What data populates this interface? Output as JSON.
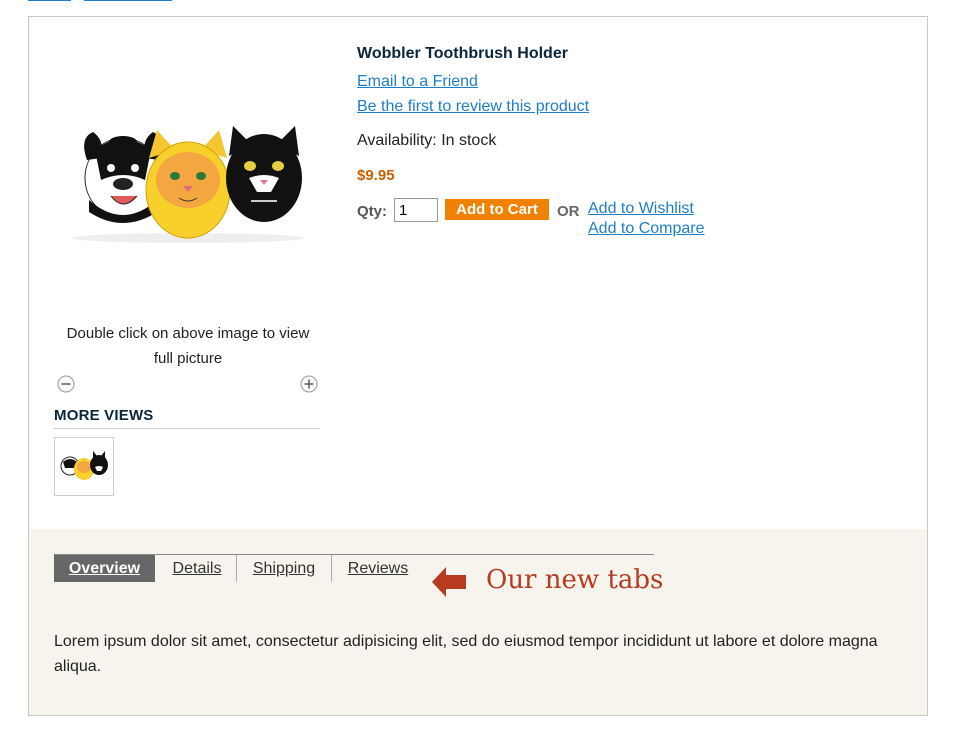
{
  "product": {
    "title": "Wobbler Toothbrush Holder",
    "email_link": "Email to a Friend",
    "review_link": "Be the first to review this product",
    "availability": "Availability: In stock",
    "price": "$9.95",
    "qty_label": "Qty:",
    "qty_value": "1",
    "add_to_cart": "Add to Cart",
    "or_text": "OR",
    "wishlist_link": "Add to Wishlist",
    "compare_link": "Add to Compare"
  },
  "media": {
    "caption": "Double click on above image to view full picture",
    "more_views": "MORE VIEWS"
  },
  "tabs": {
    "items": [
      "Overview",
      "Details",
      "Shipping",
      "Reviews"
    ],
    "active": "Overview",
    "content": "Lorem ipsum dolor sit amet, consectetur adipisicing elit, sed do eiusmod tempor incididunt ut labore et dolore magna aliqua."
  },
  "annotation": {
    "text": "Our new tabs"
  },
  "colors": {
    "link": "#1e7ec8",
    "price": "#c76200",
    "cart_button": "#f18200",
    "title": "#0a263c",
    "annotation": "#b73b21",
    "active_tab": "#666666",
    "tabs_background": "#f7f4ee"
  }
}
